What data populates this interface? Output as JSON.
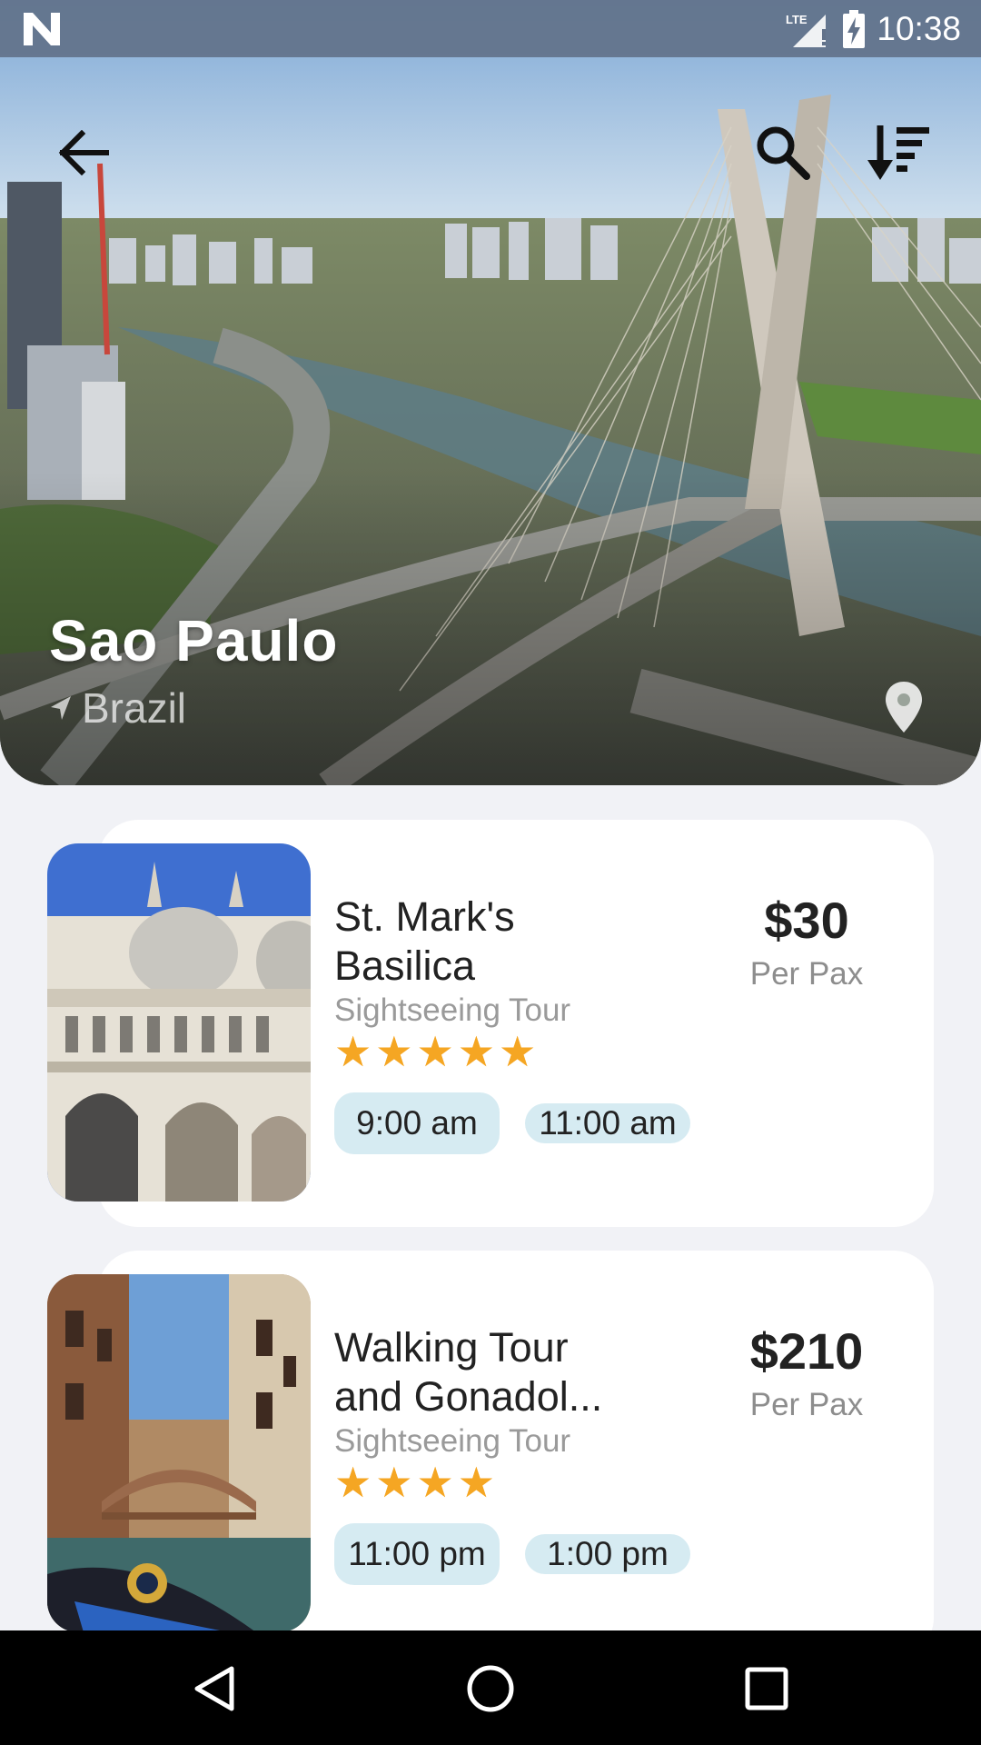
{
  "status": {
    "time": "10:38",
    "network": "LTE"
  },
  "header": {
    "back_icon": "arrow-back-icon",
    "search_icon": "search-icon",
    "sort_icon": "sort-icon"
  },
  "destination": {
    "city": "Sao Paulo",
    "country": "Brazil"
  },
  "tours": [
    {
      "title": "St. Mark's Basilica",
      "type": "Sightseeing Tour",
      "rating": 5,
      "price": "$30",
      "unit": "Per Pax",
      "times": [
        "9:00 am",
        "11:00 am"
      ]
    },
    {
      "title": "Walking Tour and Gonadol...",
      "type": "Sightseeing Tour",
      "rating": 4,
      "price": "$210",
      "unit": "Per Pax",
      "times": [
        "11:00 pm",
        "1:00 pm"
      ]
    }
  ],
  "colors": {
    "star": "#f5a623",
    "chip": "#d6ebf2",
    "status_bar": "#62728a"
  },
  "nav": {
    "back": "triangle-back-icon",
    "home": "circle-home-icon",
    "recents": "square-recents-icon"
  }
}
